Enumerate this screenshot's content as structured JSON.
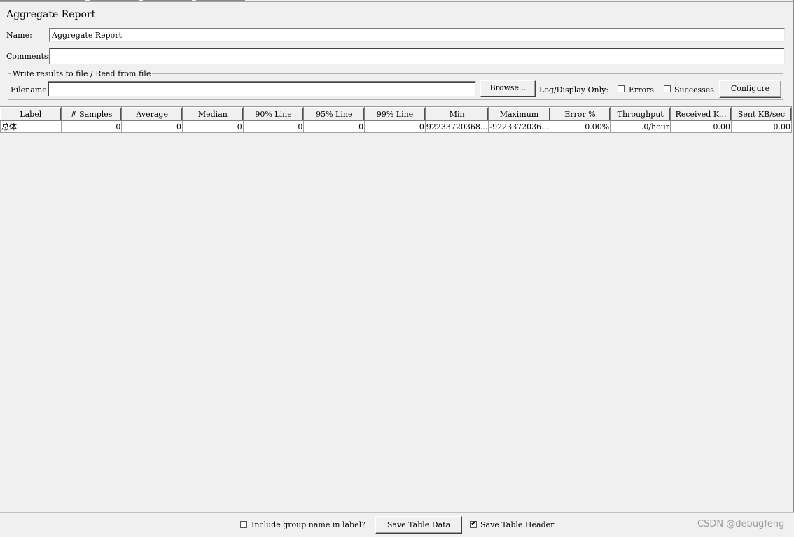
{
  "panel": {
    "title": "Aggregate Report",
    "name_label": "Name:",
    "name_value": "Aggregate Report",
    "comments_label": "Comments:",
    "comments_value": ""
  },
  "file_group": {
    "legend": "Write results to file / Read from file",
    "filename_label": "Filename",
    "filename_value": "",
    "browse_label": "Browse...",
    "log_display_label": "Log/Display Only:",
    "errors_label": "Errors",
    "errors_checked": false,
    "successes_label": "Successes",
    "successes_checked": false,
    "configure_label": "Configure"
  },
  "table": {
    "columns": [
      "Label",
      "# Samples",
      "Average",
      "Median",
      "90% Line",
      "95% Line",
      "99% Line",
      "Min",
      "Maximum",
      "Error %",
      "Throughput",
      "Received K...",
      "Sent KB/sec"
    ],
    "rows": [
      [
        "总体",
        "0",
        "0",
        "0",
        "0",
        "0",
        "0",
        "92233720368...",
        "-9223372036...",
        "0.00%",
        ".0/hour",
        "0.00",
        "0.00"
      ]
    ]
  },
  "footer": {
    "include_group_label": "Include group name in label?",
    "include_group_checked": false,
    "save_table_data_label": "Save Table Data",
    "save_table_header_label": "Save Table Header",
    "save_table_header_checked": true,
    "check_mark": "✔"
  },
  "watermark": "CSDN @debugfeng"
}
